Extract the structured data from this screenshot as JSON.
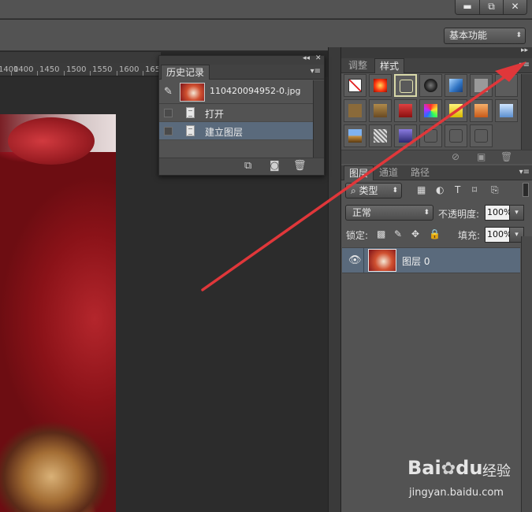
{
  "window": {
    "minimize_glyph": "▬",
    "restore_glyph": "⧉",
    "close_glyph": "✕"
  },
  "workspace": {
    "label": "基本功能"
  },
  "ruler": {
    "ticks": [
      "1400",
      "1450",
      "1500",
      "1550",
      "1600",
      "165"
    ]
  },
  "history_panel": {
    "title": "历史记录",
    "snapshot_label": "110420094952-0.jpg",
    "steps": [
      "打开",
      "建立图层"
    ],
    "selected_step": "建立图层"
  },
  "styles_panel": {
    "tabs": [
      "调整",
      "样式"
    ],
    "active_tab": "样式"
  },
  "layers_panel": {
    "tabs": [
      "图层",
      "通道",
      "路径"
    ],
    "active_tab": "图层",
    "filter_label": "类型",
    "blend_mode": "正常",
    "opacity_label": "不透明度:",
    "opacity_value": "100%",
    "lock_label": "锁定:",
    "fill_label": "填充:",
    "fill_value": "100%",
    "layer_name": "图层 0"
  },
  "watermark": {
    "brand": "Bai",
    "brand_end": "du",
    "site_cn": "经验",
    "url": "jingyan.baidu.com"
  },
  "colors": {
    "annotation_arrow": "#e0373a",
    "selection_highlight": "#5a6a7c"
  },
  "icons": [
    "brush-icon",
    "new-snapshot-icon",
    "camera-icon",
    "trash-icon",
    "eye-icon",
    "panel-menu-icon",
    "lock-icon",
    "move-icon"
  ]
}
